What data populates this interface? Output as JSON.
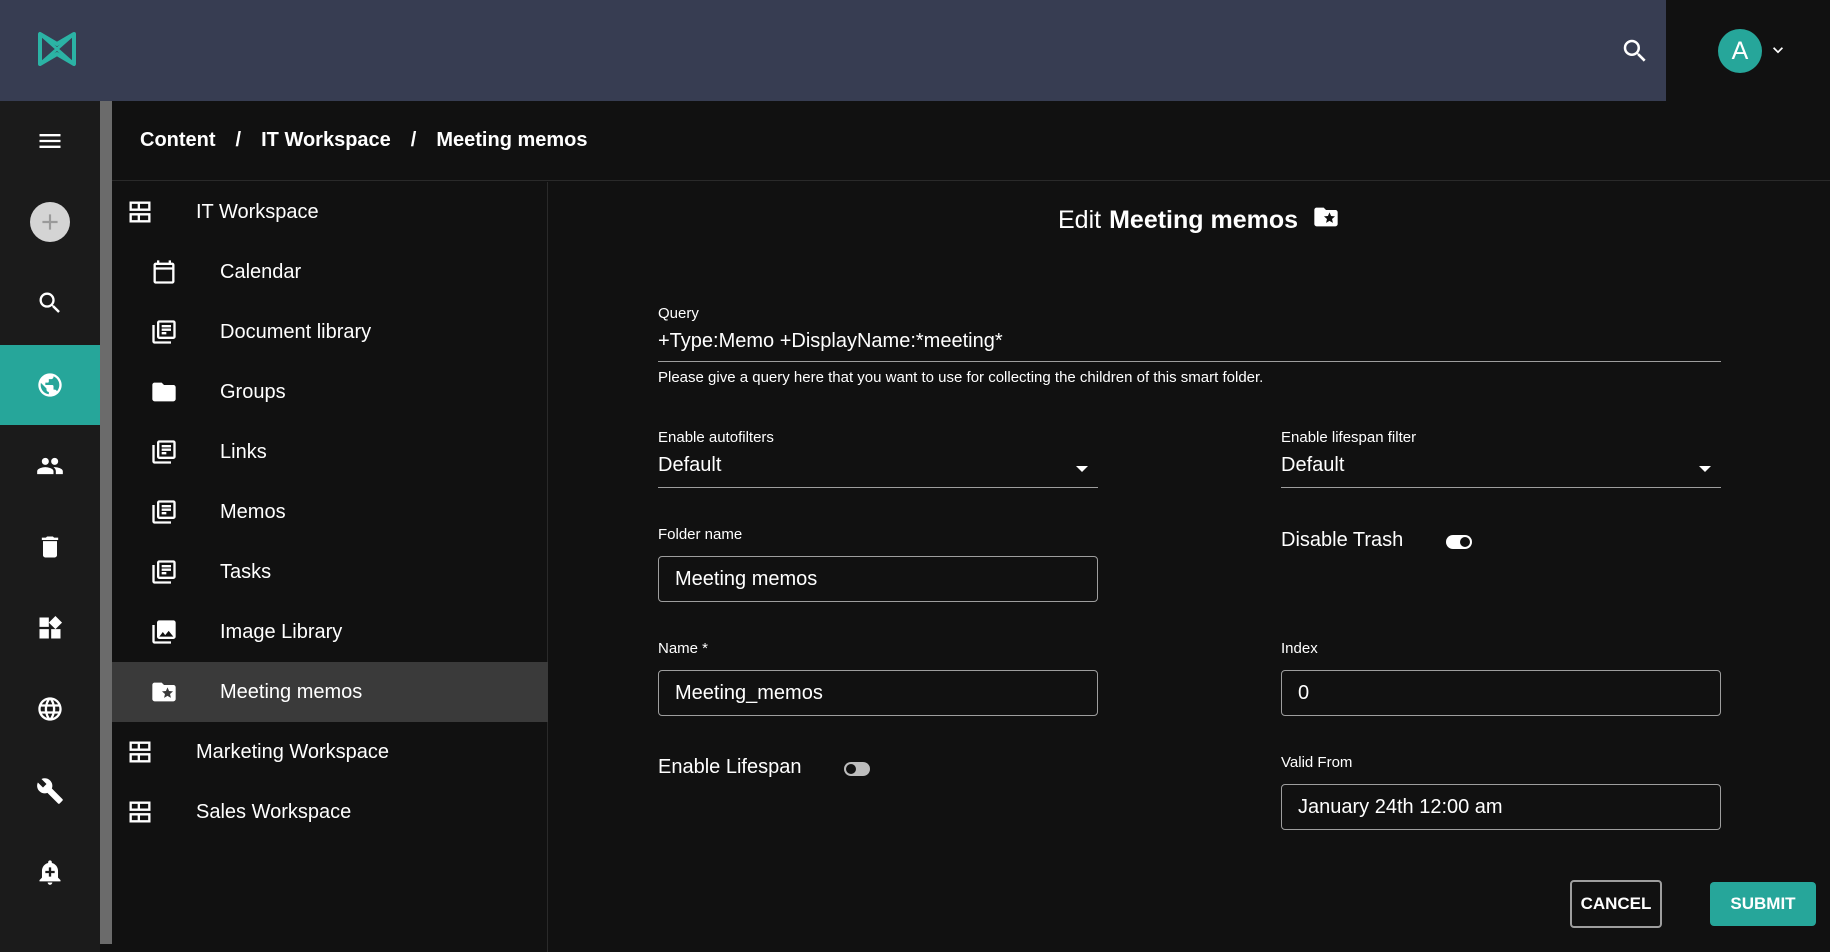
{
  "header": {
    "logo_icon": "sensenet-logo-icon",
    "search_icon": "search-icon",
    "avatar_letter": "A",
    "avatar_color": "#26a69a"
  },
  "rail": {
    "items": [
      {
        "name": "menu-icon"
      },
      {
        "name": "add-icon"
      },
      {
        "name": "search-icon"
      },
      {
        "name": "globe-content-icon",
        "active": true
      },
      {
        "name": "users-icon"
      },
      {
        "name": "trash-icon"
      },
      {
        "name": "dashboard-icon"
      },
      {
        "name": "language-icon"
      },
      {
        "name": "wrench-icon"
      },
      {
        "name": "alarm-add-icon"
      }
    ],
    "accent": "#26a69a"
  },
  "breadcrumb": {
    "items": [
      "Content",
      "IT Workspace",
      "Meeting memos"
    ],
    "separator": "/"
  },
  "tree": {
    "items": [
      {
        "label": "IT Workspace",
        "icon": "workspace-icon"
      },
      {
        "label": "Calendar",
        "icon": "calendar-icon"
      },
      {
        "label": "Document library",
        "icon": "library-icon"
      },
      {
        "label": "Groups",
        "icon": "folder-icon"
      },
      {
        "label": "Links",
        "icon": "library-icon"
      },
      {
        "label": "Memos",
        "icon": "library-icon"
      },
      {
        "label": "Tasks",
        "icon": "library-icon"
      },
      {
        "label": "Image Library",
        "icon": "image-library-icon"
      },
      {
        "label": "Meeting memos",
        "icon": "smart-folder-icon",
        "selected": true
      },
      {
        "label": "Marketing Workspace",
        "icon": "workspace-icon"
      },
      {
        "label": "Sales Workspace",
        "icon": "workspace-icon"
      }
    ]
  },
  "form": {
    "title_prefix": "Edit",
    "title_name": "Meeting memos",
    "title_icon": "smart-folder-icon",
    "query": {
      "label": "Query",
      "value": "+Type:Memo +DisplayName:*meeting*",
      "help": "Please give a query here that you want to use for collecting the children of this smart folder."
    },
    "enable_autofilters": {
      "label": "Enable autofilters",
      "value": "Default"
    },
    "enable_lifespan_filter": {
      "label": "Enable lifespan filter",
      "value": "Default"
    },
    "folder_name": {
      "label": "Folder name",
      "value": "Meeting memos"
    },
    "disable_trash": {
      "label": "Disable Trash",
      "checked": true
    },
    "name": {
      "label": "Name *",
      "value": "Meeting_memos"
    },
    "index": {
      "label": "Index",
      "value": "0"
    },
    "enable_lifespan": {
      "label": "Enable Lifespan",
      "checked": false
    },
    "valid_from": {
      "label": "Valid From",
      "value": "January 24th 12:00 am"
    },
    "cancel_label": "CANCEL",
    "submit_label": "SUBMIT"
  }
}
